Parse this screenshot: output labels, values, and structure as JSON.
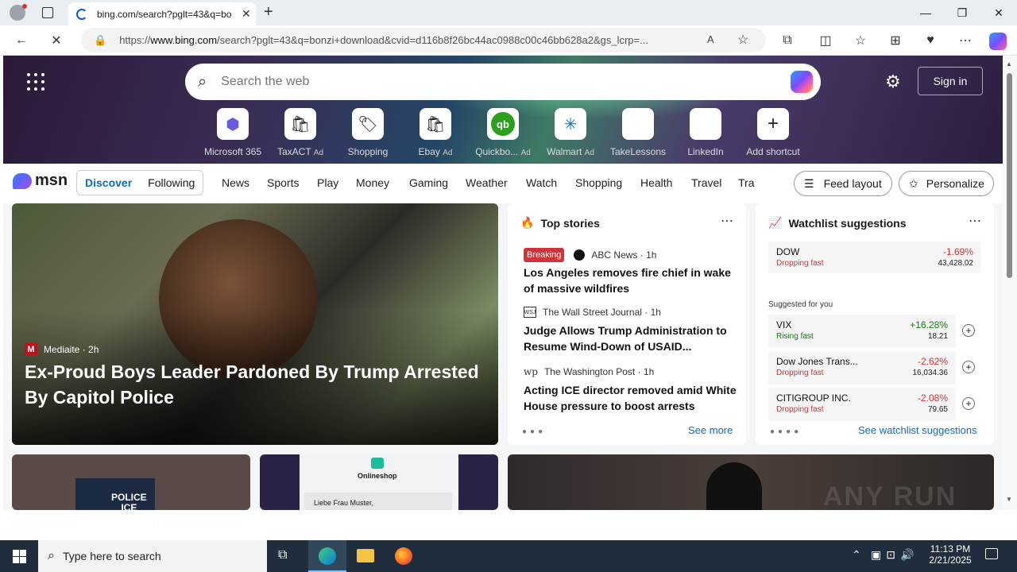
{
  "browser": {
    "tab_title": "bing.com/search?pglt=43&q=bo",
    "url_prefix": "https://",
    "url_host": "www.bing.com",
    "url_rest": "/search?pglt=43&q=bonzi+download&cvid=d116b8f26bc44ac0988c00c46bb628a2&gs_lcrp=..."
  },
  "search": {
    "placeholder": "Search the web"
  },
  "signin_label": "Sign in",
  "shortcuts": [
    {
      "label": "Microsoft 365",
      "ad": ""
    },
    {
      "label": "TaxACT",
      "ad": "Ad"
    },
    {
      "label": "Shopping",
      "ad": ""
    },
    {
      "label": "Ebay",
      "ad": "Ad"
    },
    {
      "label": "Quickbo...",
      "ad": "Ad"
    },
    {
      "label": "Walmart",
      "ad": "Ad"
    },
    {
      "label": "TakeLessons",
      "ad": ""
    },
    {
      "label": "LinkedIn",
      "ad": ""
    },
    {
      "label": "Add shortcut",
      "ad": ""
    }
  ],
  "msn": {
    "logo": "msn",
    "seg": [
      "Discover",
      "Following"
    ],
    "categories": [
      "News",
      "Sports",
      "Play",
      "Money",
      "Gaming",
      "Weather",
      "Watch",
      "Shopping",
      "Health",
      "Travel",
      "Tra"
    ],
    "feed_layout": "Feed layout",
    "personalize": "Personalize"
  },
  "hero": {
    "source": "Mediaite",
    "time": "2h",
    "title": "Ex-Proud Boys Leader Pardoned By Trump Arrested By Capitol Police"
  },
  "top_stories": {
    "header": "Top stories",
    "breaking": "Breaking",
    "items": [
      {
        "source": "ABC News · 1h",
        "title": "Los Angeles removes fire chief in wake of massive wildfires"
      },
      {
        "source": "The Wall Street Journal · 1h",
        "title": "Judge Allows Trump Administration to Resume Wind-Down of USAID..."
      },
      {
        "source": "The Washington Post · 1h",
        "title": "Acting ICE director removed amid White House pressure to boost arrests"
      }
    ],
    "see_more": "See more"
  },
  "watchlist": {
    "header": "Watchlist suggestions",
    "suggested": "Suggested for you",
    "items": [
      {
        "name": "DOW",
        "status": "Dropping fast",
        "pct": "-1.69%",
        "value": "43,428.02"
      },
      {
        "name": "VIX",
        "status": "Rising fast",
        "pct": "+16.28%",
        "value": "18.21"
      },
      {
        "name": "Dow Jones Trans...",
        "status": "Dropping fast",
        "pct": "-2.62%",
        "value": "16,034.36"
      },
      {
        "name": "CITIGROUP INC.",
        "status": "Dropping fast",
        "pct": "-2.08%",
        "value": "79.65"
      }
    ],
    "see_all": "See watchlist suggestions"
  },
  "lower": {
    "onlineshop": "Onlineshop",
    "letter": "Liebe Frau Muster,",
    "police": "POLICE",
    "ice": "ICE"
  },
  "watermark": "ANY RUN",
  "taskbar": {
    "search_placeholder": "Type here to search",
    "time": "11:13 PM",
    "date": "2/21/2025"
  },
  "colors": {
    "red": "#d13438",
    "green": "#107c10",
    "blue": "#0f6cbd"
  }
}
